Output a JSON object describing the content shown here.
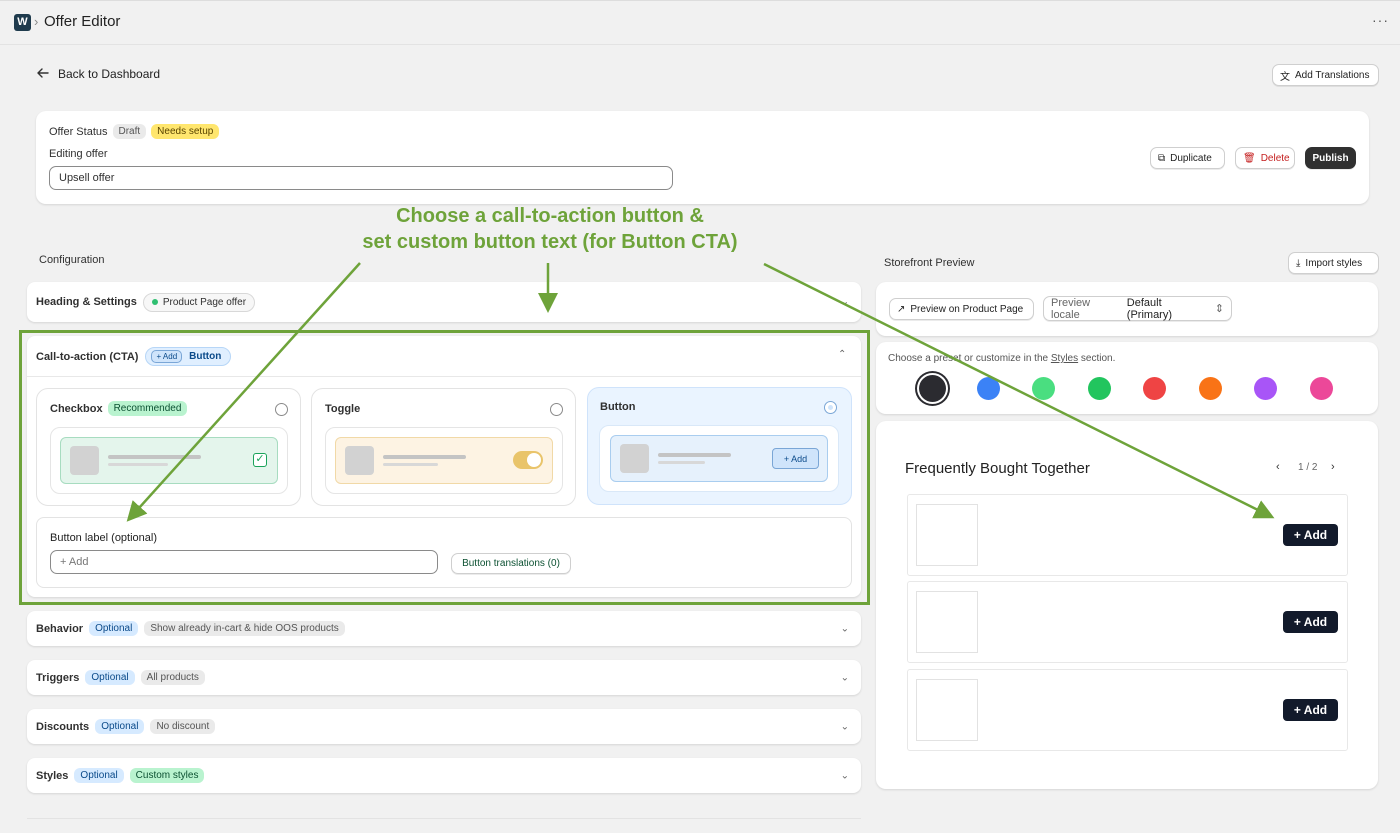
{
  "topbar": {
    "app_title": "Offer Editor",
    "logo_letter": "W",
    "more": "···"
  },
  "nav": {
    "back": "Back to Dashboard",
    "add_translations": "Add Translations"
  },
  "status": {
    "label": "Offer Status",
    "badge_draft": "Draft",
    "badge_setup": "Needs setup",
    "editing_label": "Editing offer",
    "offer_name": "Upsell offer",
    "duplicate": "Duplicate",
    "delete": "Delete",
    "publish": "Publish"
  },
  "annotation": {
    "line1": "Choose a call-to-action button &",
    "line2": "set custom button text (for Button CTA)"
  },
  "config": {
    "title": "Configuration",
    "heading_settings": {
      "label": "Heading & Settings",
      "badge": "Product Page offer"
    },
    "cta": {
      "label": "Call-to-action (CTA)",
      "chip_add": "+ Add",
      "chip_label": "Button",
      "options": [
        {
          "name": "Checkbox",
          "badge": "Recommended"
        },
        {
          "name": "Toggle"
        },
        {
          "name": "Button",
          "mini_add": "+ Add"
        }
      ],
      "button_label_title": "Button label (optional)",
      "button_label_placeholder": "+ Add",
      "button_translations": "Button translations (0)"
    },
    "behavior": {
      "label": "Behavior",
      "badge_optional": "Optional",
      "badge_detail": "Show already in-cart & hide OOS products"
    },
    "triggers": {
      "label": "Triggers",
      "badge_optional": "Optional",
      "badge_detail": "All products"
    },
    "discounts": {
      "label": "Discounts",
      "badge_optional": "Optional",
      "badge_detail": "No discount"
    },
    "styles": {
      "label": "Styles",
      "badge_optional": "Optional",
      "badge_detail": "Custom styles"
    }
  },
  "preview": {
    "title": "Storefront Preview",
    "import_styles": "Import styles",
    "preview_product": "Preview on Product Page",
    "locale_label": "Preview locale",
    "locale_value": "Default (Primary)",
    "preset_text_before": "Choose a preset or customize in the",
    "preset_link": "Styles",
    "preset_text_after": "section.",
    "swatches": [
      "#2b2b30",
      "#3b82f6",
      "#4ade80",
      "#22c55e",
      "#ef4444",
      "#f97316",
      "#a855f7",
      "#ec4899"
    ],
    "fbt_title": "Frequently Bought Together",
    "pager": "1 / 2",
    "add_label": "+ Add"
  },
  "colors": {
    "annotation_green": "#6ea33a",
    "publish_bg": "#303030",
    "delete_red": "#c41e1e"
  }
}
